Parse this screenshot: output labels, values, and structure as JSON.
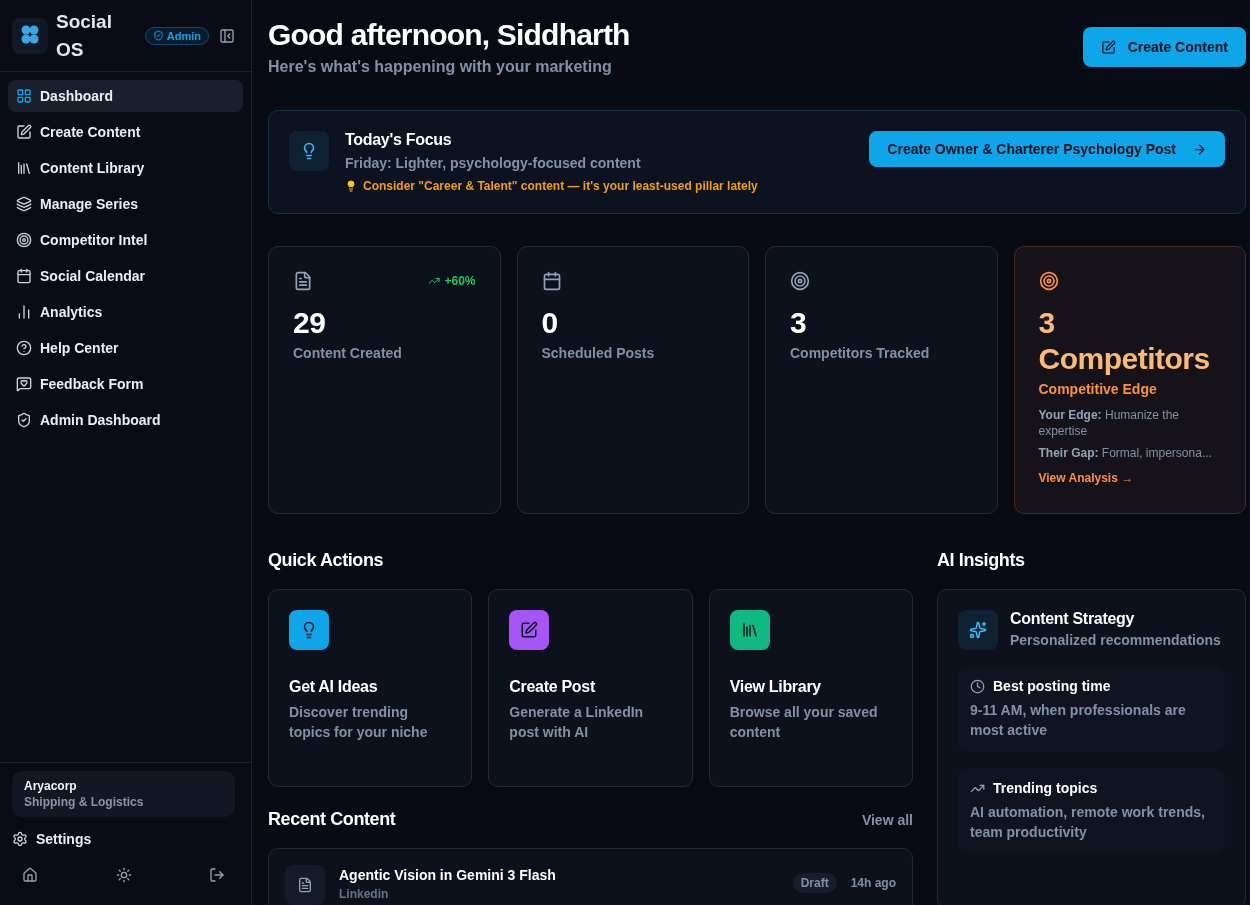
{
  "brand": {
    "name": "Social OS",
    "badge": "Admin"
  },
  "sidebar": {
    "items": [
      {
        "label": "Dashboard",
        "selected": true
      },
      {
        "label": "Create Content",
        "selected": false
      },
      {
        "label": "Content Library",
        "selected": false
      },
      {
        "label": "Manage Series",
        "selected": false
      },
      {
        "label": "Competitor Intel",
        "selected": false
      },
      {
        "label": "Social Calendar",
        "selected": false
      },
      {
        "label": "Analytics",
        "selected": false
      },
      {
        "label": "Help Center",
        "selected": false
      },
      {
        "label": "Feedback Form",
        "selected": false
      },
      {
        "label": "Admin Dashboard",
        "selected": false
      }
    ],
    "workspace": {
      "name": "Aryacorp",
      "industry": "Shipping & Logistics"
    },
    "settings": "Settings"
  },
  "header": {
    "greeting": "Good afternoon, Siddharth",
    "subtitle": "Here's what's happening with your marketing",
    "button": "Create Content"
  },
  "focus": {
    "title": "Today's Focus",
    "subtitle": "Friday: Lighter, psychology-focused content",
    "tip": "Consider \"Career & Talent\" content — it's your least-used pillar lately",
    "button": "Create Owner & Charterer Psychology Post"
  },
  "stats": [
    {
      "kind": "stat",
      "value": "29",
      "label": "Content Created",
      "trend": "+60%"
    },
    {
      "kind": "stat",
      "value": "0",
      "label": "Scheduled Posts"
    },
    {
      "kind": "stat",
      "value": "3",
      "label": "Competitors Tracked"
    },
    {
      "kind": "competitor",
      "value": "3 Competitors",
      "label": "Competitive Edge",
      "edge": "**Your Edge:** Humanize the expertise",
      "gap": "**Their Gap:** Formal, impersona...",
      "link": "View Analysis →"
    }
  ],
  "quick_actions": {
    "title": "Quick Actions",
    "items": [
      {
        "title": "Get AI Ideas",
        "description": "Discover trending topics for your niche",
        "color": "#0ea5e9"
      },
      {
        "title": "Create Post",
        "description": "Generate a LinkedIn post with AI",
        "color": "#a855f7"
      },
      {
        "title": "View Library",
        "description": "Browse all your saved content",
        "color": "#10b981"
      }
    ]
  },
  "recent": {
    "title": "Recent Content",
    "link": "View all",
    "items": [
      {
        "title": "Agentic Vision in Gemini 3 Flash",
        "platform": "Linkedin",
        "status": "Draft",
        "time": "14h ago"
      }
    ]
  },
  "insights": {
    "title": "AI Insights",
    "card_title": "Content Strategy",
    "card_subtitle": "Personalized recommendations",
    "tips": [
      {
        "title": "Best posting time",
        "text": "9-11 AM, when professionals are most active"
      },
      {
        "title": "Trending topics",
        "text": "AI automation, remote work trends, team productivity"
      }
    ]
  }
}
